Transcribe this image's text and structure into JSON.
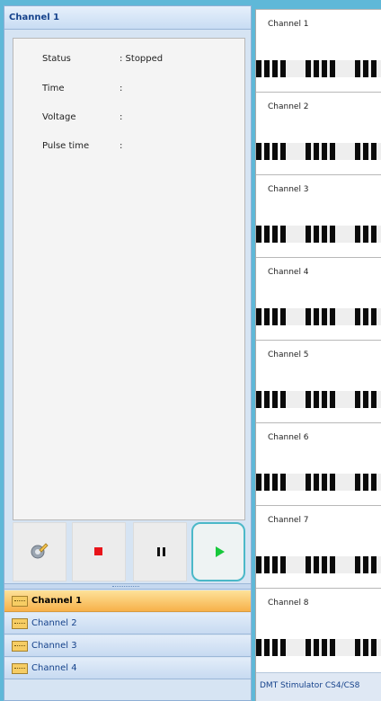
{
  "left_panel": {
    "header": "Channel 1",
    "info": [
      {
        "key": "Status",
        "value": ": Stopped"
      },
      {
        "key": "Time",
        "value": ":"
      },
      {
        "key": "Voltage",
        "value": ":"
      },
      {
        "key": "Pulse time",
        "value": ":"
      }
    ],
    "controls": {
      "configure_icon": "settings-pencil-icon",
      "stop_icon": "stop-icon",
      "pause_icon": "pause-icon",
      "play_icon": "play-icon"
    },
    "nav": [
      "Channel 1",
      "Channel 2",
      "Channel 3",
      "Channel 4"
    ],
    "active_nav_index": 0
  },
  "right_panel": {
    "channels": [
      "Channel 1",
      "Channel 2",
      "Channel 3",
      "Channel 4",
      "Channel 5",
      "Channel 6",
      "Channel 7",
      "Channel 8"
    ],
    "status": "DMT Stimulator CS4/CS8"
  },
  "colors": {
    "accent_border": "#4bb8c8",
    "active_nav": "#f7b14a",
    "stop": "#e8141a",
    "play": "#16c83a"
  }
}
